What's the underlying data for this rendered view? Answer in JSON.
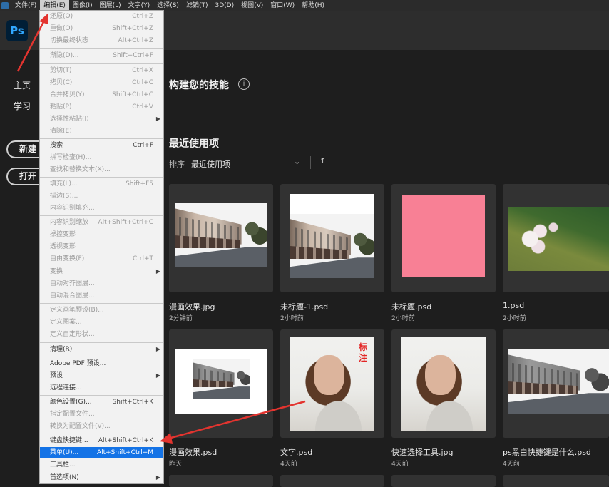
{
  "menubar": {
    "items": [
      "文件(F)",
      "编辑(E)",
      "图像(I)",
      "图层(L)",
      "文字(Y)",
      "选择(S)",
      "滤镜(T)",
      "3D(D)",
      "视图(V)",
      "窗口(W)",
      "帮助(H)"
    ],
    "active_index": 1
  },
  "app": {
    "logo": "Ps"
  },
  "left_nav": {
    "home": "主页",
    "learn": "学习",
    "new": "新建",
    "open": "打开"
  },
  "main": {
    "skills_title": "构建您的技能",
    "info_icon": "i",
    "recent_title": "最近使用项",
    "sort_label": "排序",
    "sort_value": "最近使用项",
    "sort_chevron": "⌄",
    "sort_arrow": "↑",
    "stamp_text": "标注",
    "files": [
      {
        "name": "漫画效果.jpg",
        "time": "2分钟前"
      },
      {
        "name": "未标题-1.psd",
        "time": "2小时前"
      },
      {
        "name": "未标题.psd",
        "time": "2小时前"
      },
      {
        "name": "1.psd",
        "time": "2小时前"
      },
      {
        "name": "漫画效果.psd",
        "time": "昨天"
      },
      {
        "name": "文字.psd",
        "time": "4天前"
      },
      {
        "name": "快速选择工具.jpg",
        "time": "4天前"
      },
      {
        "name": "ps黑白快捷键是什么.psd",
        "time": "4天前"
      }
    ]
  },
  "edit_menu": {
    "items": [
      {
        "label": "还原(O)",
        "shortcut": "Ctrl+Z",
        "disabled": true
      },
      {
        "label": "重做(O)",
        "shortcut": "Shift+Ctrl+Z",
        "disabled": true
      },
      {
        "label": "切换最终状态",
        "shortcut": "Alt+Ctrl+Z",
        "disabled": true
      },
      {
        "label": "渐隐(D)...",
        "shortcut": "Shift+Ctrl+F",
        "disabled": true
      },
      {
        "label": "剪切(T)",
        "shortcut": "Ctrl+X",
        "disabled": true
      },
      {
        "label": "拷贝(C)",
        "shortcut": "Ctrl+C",
        "disabled": true
      },
      {
        "label": "合并拷贝(Y)",
        "shortcut": "Shift+Ctrl+C",
        "disabled": true
      },
      {
        "label": "粘贴(P)",
        "shortcut": "Ctrl+V",
        "disabled": true
      },
      {
        "label": "选择性粘贴(I)",
        "shortcut": "",
        "disabled": true,
        "submenu": true
      },
      {
        "label": "清除(E)",
        "shortcut": "",
        "disabled": true
      },
      {
        "label": "搜索",
        "shortcut": "Ctrl+F",
        "disabled": false
      },
      {
        "label": "拼写检查(H)...",
        "shortcut": "",
        "disabled": true
      },
      {
        "label": "查找和替换文本(X)...",
        "shortcut": "",
        "disabled": true
      },
      {
        "label": "填充(L)...",
        "shortcut": "Shift+F5",
        "disabled": true
      },
      {
        "label": "描边(S)...",
        "shortcut": "",
        "disabled": true
      },
      {
        "label": "内容识别填充...",
        "shortcut": "",
        "disabled": true
      },
      {
        "label": "内容识别缩放",
        "shortcut": "Alt+Shift+Ctrl+C",
        "disabled": true
      },
      {
        "label": "操控变形",
        "shortcut": "",
        "disabled": true
      },
      {
        "label": "透视变形",
        "shortcut": "",
        "disabled": true
      },
      {
        "label": "自由变换(F)",
        "shortcut": "Ctrl+T",
        "disabled": true
      },
      {
        "label": "变换",
        "shortcut": "",
        "disabled": true,
        "submenu": true
      },
      {
        "label": "自动对齐图层...",
        "shortcut": "",
        "disabled": true
      },
      {
        "label": "自动混合图层...",
        "shortcut": "",
        "disabled": true
      },
      {
        "label": "定义画笔预设(B)...",
        "shortcut": "",
        "disabled": true
      },
      {
        "label": "定义图案...",
        "shortcut": "",
        "disabled": true
      },
      {
        "label": "定义自定形状...",
        "shortcut": "",
        "disabled": true
      },
      {
        "label": "清理(R)",
        "shortcut": "",
        "disabled": false,
        "submenu": true
      },
      {
        "label": "Adobe PDF 预设...",
        "shortcut": "",
        "disabled": false
      },
      {
        "label": "预设",
        "shortcut": "",
        "disabled": false,
        "submenu": true
      },
      {
        "label": "远程连接...",
        "shortcut": "",
        "disabled": false
      },
      {
        "label": "颜色设置(G)...",
        "shortcut": "Shift+Ctrl+K",
        "disabled": false
      },
      {
        "label": "指定配置文件...",
        "shortcut": "",
        "disabled": true
      },
      {
        "label": "转换为配置文件(V)...",
        "shortcut": "",
        "disabled": true
      },
      {
        "label": "键盘快捷键...",
        "shortcut": "Alt+Shift+Ctrl+K",
        "disabled": false
      },
      {
        "label": "菜单(U)...",
        "shortcut": "Alt+Shift+Ctrl+M",
        "disabled": false,
        "highlight": true
      },
      {
        "label": "工具栏...",
        "shortcut": "",
        "disabled": false
      },
      {
        "label": "首选项(N)",
        "shortcut": "",
        "disabled": false,
        "submenu": true
      }
    ]
  },
  "colors": {
    "accent": "#1473e6",
    "annotation": "#e3342f",
    "ps_blue": "#31a8ff",
    "ps_dark": "#001e36"
  }
}
